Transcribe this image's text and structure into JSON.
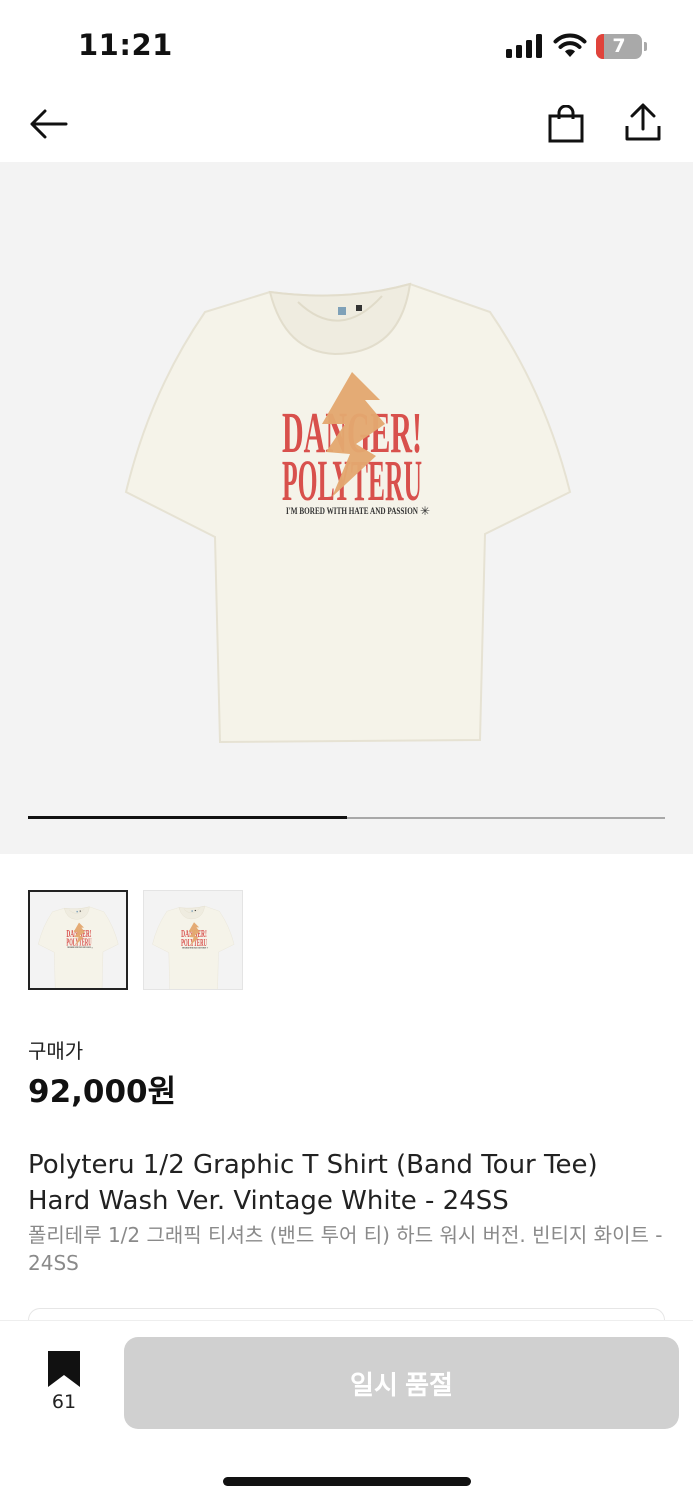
{
  "status_bar": {
    "time": "11:21",
    "battery_level": "7",
    "battery_color": "#e0433b"
  },
  "nav": {
    "back_icon": "arrow-left-icon",
    "bag_icon": "shopping-bag-icon",
    "share_icon": "share-icon"
  },
  "gallery": {
    "current_image": 1,
    "total_images": 2,
    "progress_fraction": 0.5,
    "print_text": {
      "line1": "DANGER!",
      "line2": "POLYTERU",
      "tagline": "I'M BORED WITH HATE AND PASSION"
    },
    "shirt_color": "#f5f3e9",
    "print_red": "#d8504c",
    "print_orange": "#e3a86f"
  },
  "thumbnails": [
    {
      "active": true
    },
    {
      "active": false
    }
  ],
  "price": {
    "label": "구매가",
    "value": "92,000원"
  },
  "product": {
    "name_en": "Polyteru 1/2 Graphic T Shirt (Band Tour Tee) Hard Wash Ver. Vintage White - 24SS",
    "name_ko": "폴리테루 1/2 그래픽 티셔츠 (밴드 투어 티) 하드 워시 버전. 빈티지 화이트 - 24SS"
  },
  "bottom_bar": {
    "bookmark_icon": "bookmark-icon",
    "bookmark_count": "61",
    "action_label": "일시 품절",
    "action_color": "#d0d0d0"
  }
}
